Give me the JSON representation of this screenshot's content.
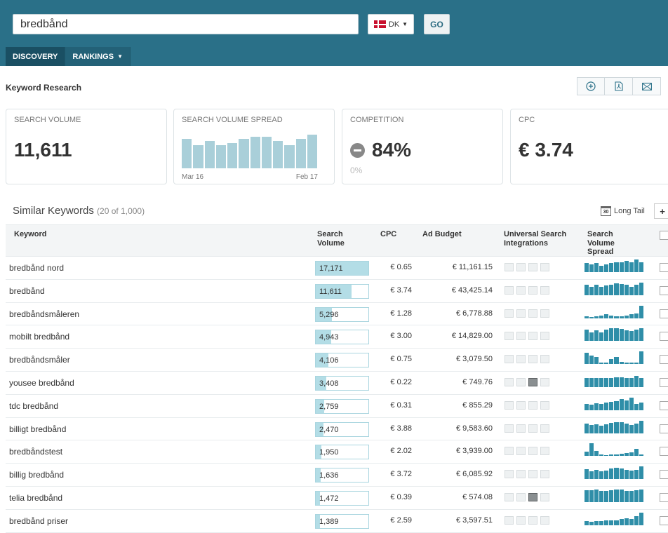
{
  "search": {
    "value": "bredbånd",
    "country": "DK",
    "go_label": "GO",
    "country_color": "#c8102e"
  },
  "nav": {
    "discovery": "DISCOVERY",
    "rankings": "RANKINGS"
  },
  "page": {
    "title": "Keyword Research"
  },
  "toolbar": {
    "icons": [
      "add-circle-icon",
      "pdf-icon",
      "email-icon"
    ]
  },
  "cards": {
    "search_volume": {
      "label": "SEARCH VOLUME",
      "value": "11,611"
    },
    "spread": {
      "label": "SEARCH VOLUME SPREAD",
      "start": "Mar 16",
      "end": "Feb 17",
      "levels": [
        0.84,
        0.66,
        0.78,
        0.66,
        0.72,
        0.84,
        0.9,
        0.9,
        0.78,
        0.66,
        0.84,
        0.96
      ]
    },
    "competition": {
      "label": "COMPETITION",
      "value": "84%",
      "sub": "0%"
    },
    "cpc": {
      "label": "CPC",
      "value": "€ 3.74"
    }
  },
  "similar": {
    "title": "Similar Keywords",
    "count": "(20 of 1,000)",
    "longtail": "Long Tail",
    "cal_day": "30",
    "plus": "+"
  },
  "table": {
    "headers": {
      "keyword": "Keyword",
      "volume": "Search Volume",
      "cpc": "CPC",
      "budget": "Ad Budget",
      "usi": "Universal Search Integrations",
      "spread": "Search Volume Spread"
    },
    "rows": [
      {
        "keyword": "bredbånd nord",
        "volume": "17,171",
        "vol_frac": 1.0,
        "cpc": "€ 0.65",
        "budget": "€ 11,161.15",
        "usi": [
          0,
          0,
          0,
          0
        ],
        "spread": [
          0.7,
          0.6,
          0.7,
          0.5,
          0.6,
          0.7,
          0.8,
          0.8,
          0.9,
          0.8,
          1.0,
          0.8
        ]
      },
      {
        "keyword": "bredbånd",
        "volume": "11,611",
        "vol_frac": 0.68,
        "cpc": "€ 3.74",
        "budget": "€ 43,425.14",
        "usi": [
          0,
          0,
          0,
          0
        ],
        "spread": [
          0.85,
          0.65,
          0.8,
          0.65,
          0.75,
          0.85,
          0.95,
          0.9,
          0.8,
          0.65,
          0.85,
          1.0
        ]
      },
      {
        "keyword": "bredbåndsmåleren",
        "volume": "5,296",
        "vol_frac": 0.31,
        "cpc": "€ 1.28",
        "budget": "€ 6,778.88",
        "usi": [
          0,
          0,
          0,
          0
        ],
        "spread": [
          0.15,
          0.1,
          0.15,
          0.2,
          0.3,
          0.2,
          0.15,
          0.15,
          0.2,
          0.3,
          0.35,
          1.0
        ]
      },
      {
        "keyword": "mobilt bredbånd",
        "volume": "4,943",
        "vol_frac": 0.29,
        "cpc": "€ 3.00",
        "budget": "€ 14,829.00",
        "usi": [
          0,
          0,
          0,
          0
        ],
        "spread": [
          0.9,
          0.7,
          0.85,
          0.7,
          0.9,
          1.0,
          1.0,
          0.95,
          0.85,
          0.8,
          0.9,
          1.0
        ]
      },
      {
        "keyword": "bredbåndsmåler",
        "volume": "4,106",
        "vol_frac": 0.24,
        "cpc": "€ 0.75",
        "budget": "€ 3,079.50",
        "usi": [
          0,
          0,
          0,
          0
        ],
        "spread": [
          0.9,
          0.7,
          0.55,
          0.1,
          0.1,
          0.4,
          0.55,
          0.2,
          0.1,
          0.1,
          0.1,
          1.0
        ]
      },
      {
        "keyword": "yousee bredbånd",
        "volume": "3,408",
        "vol_frac": 0.2,
        "cpc": "€ 0.22",
        "budget": "€ 749.76",
        "usi": [
          0,
          0,
          1,
          0
        ],
        "spread": [
          0.7,
          0.7,
          0.7,
          0.7,
          0.7,
          0.7,
          0.75,
          0.8,
          0.7,
          0.7,
          0.9,
          0.7
        ]
      },
      {
        "keyword": "tdc bredbånd",
        "volume": "2,759",
        "vol_frac": 0.16,
        "cpc": "€ 0.31",
        "budget": "€ 855.29",
        "usi": [
          0,
          0,
          0,
          0
        ],
        "spread": [
          0.5,
          0.45,
          0.55,
          0.5,
          0.6,
          0.65,
          0.7,
          0.9,
          0.75,
          1.0,
          0.5,
          0.6
        ]
      },
      {
        "keyword": "billigt bredbånd",
        "volume": "2,470",
        "vol_frac": 0.14,
        "cpc": "€ 3.88",
        "budget": "€ 9,583.60",
        "usi": [
          0,
          0,
          0,
          0
        ],
        "spread": [
          0.75,
          0.65,
          0.7,
          0.6,
          0.7,
          0.8,
          0.85,
          0.85,
          0.75,
          0.65,
          0.75,
          1.0
        ]
      },
      {
        "keyword": "bredbåndstest",
        "volume": "1,950",
        "vol_frac": 0.11,
        "cpc": "€ 2.02",
        "budget": "€ 3,939.00",
        "usi": [
          0,
          0,
          0,
          0
        ],
        "spread": [
          0.35,
          1.0,
          0.4,
          0.15,
          0.1,
          0.15,
          0.15,
          0.2,
          0.25,
          0.3,
          0.6,
          0.15
        ]
      },
      {
        "keyword": "billig bredbånd",
        "volume": "1,636",
        "vol_frac": 0.09,
        "cpc": "€ 3.72",
        "budget": "€ 6,085.92",
        "usi": [
          0,
          0,
          0,
          0
        ],
        "spread": [
          0.8,
          0.6,
          0.75,
          0.6,
          0.7,
          0.85,
          0.9,
          0.85,
          0.75,
          0.65,
          0.75,
          1.0
        ]
      },
      {
        "keyword": "telia bredbånd",
        "volume": "1,472",
        "vol_frac": 0.08,
        "cpc": "€ 0.39",
        "budget": "€ 574.08",
        "usi": [
          0,
          0,
          1,
          0
        ],
        "spread": [
          0.95,
          0.95,
          1.0,
          0.9,
          0.9,
          0.95,
          1.0,
          1.0,
          0.9,
          0.9,
          0.95,
          1.0
        ]
      },
      {
        "keyword": "bredbånd priser",
        "volume": "1,389",
        "vol_frac": 0.08,
        "cpc": "€ 2.59",
        "budget": "€ 3,597.51",
        "usi": [
          0,
          0,
          0,
          0
        ],
        "spread": [
          0.3,
          0.25,
          0.3,
          0.3,
          0.35,
          0.35,
          0.4,
          0.5,
          0.55,
          0.5,
          0.7,
          1.0
        ]
      }
    ]
  }
}
